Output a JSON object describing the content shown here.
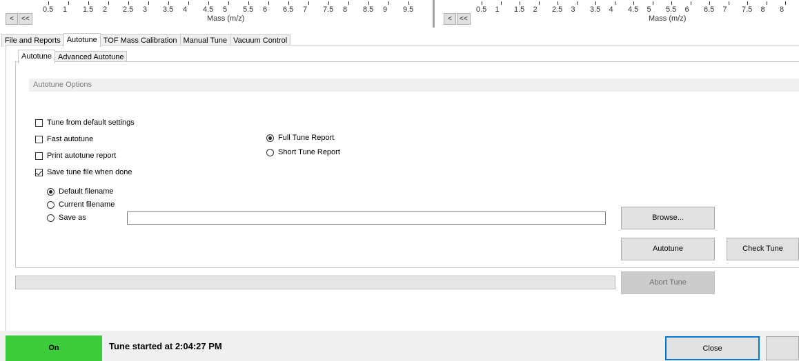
{
  "top_axis": {
    "left_ticks": [
      "0.5",
      "1",
      "1.5",
      "2",
      "2.5",
      "3",
      "3.5",
      "4",
      "4.5",
      "5",
      "5.5",
      "6",
      "6.5",
      "7",
      "7.5",
      "8",
      "8.5",
      "9",
      "9.5"
    ],
    "left_title": "Mass (m/z)",
    "right_ticks": [
      "0.5",
      "1",
      "1.5",
      "2",
      "2.5",
      "3",
      "3.5",
      "4",
      "4.5",
      "5",
      "5.5",
      "6",
      "6.5",
      "7",
      "7.5",
      "8",
      "8"
    ],
    "right_title": "Mass (m/z)",
    "nav_prev": "<",
    "nav_first": "<<"
  },
  "main_tabs": [
    "File and Reports",
    "Autotune",
    "TOF Mass Calibration",
    "Manual Tune",
    "Vacuum Control"
  ],
  "main_tab_active": "Autotune",
  "sub_tabs": [
    "Autotune",
    "Advanced Autotune"
  ],
  "sub_tab_active": "Autotune",
  "options": {
    "header": "Autotune Options",
    "checkboxes": [
      {
        "label": "Tune from default settings",
        "checked": false
      },
      {
        "label": "Fast autotune",
        "checked": false
      },
      {
        "label": "Print autotune report",
        "checked": false
      },
      {
        "label": "Save tune file when done",
        "checked": true
      }
    ],
    "report_radios": [
      {
        "label": "Full Tune Report",
        "checked": true
      },
      {
        "label": "Short Tune Report",
        "checked": false
      }
    ],
    "filename_radios": [
      {
        "label": "Default filename",
        "checked": true
      },
      {
        "label": "Current filename",
        "checked": false
      },
      {
        "label": "Save as",
        "checked": false
      }
    ],
    "saveas_value": ""
  },
  "buttons": {
    "browse": "Browse...",
    "autotune": "Autotune",
    "check_tune": "Check Tune",
    "abort_tune": "Abort Tune",
    "close": "Close"
  },
  "progress": {
    "value": 0
  },
  "status": {
    "on_label": "On",
    "message": "Tune started at 2:04:27 PM",
    "on_color": "#3bcb3b"
  }
}
